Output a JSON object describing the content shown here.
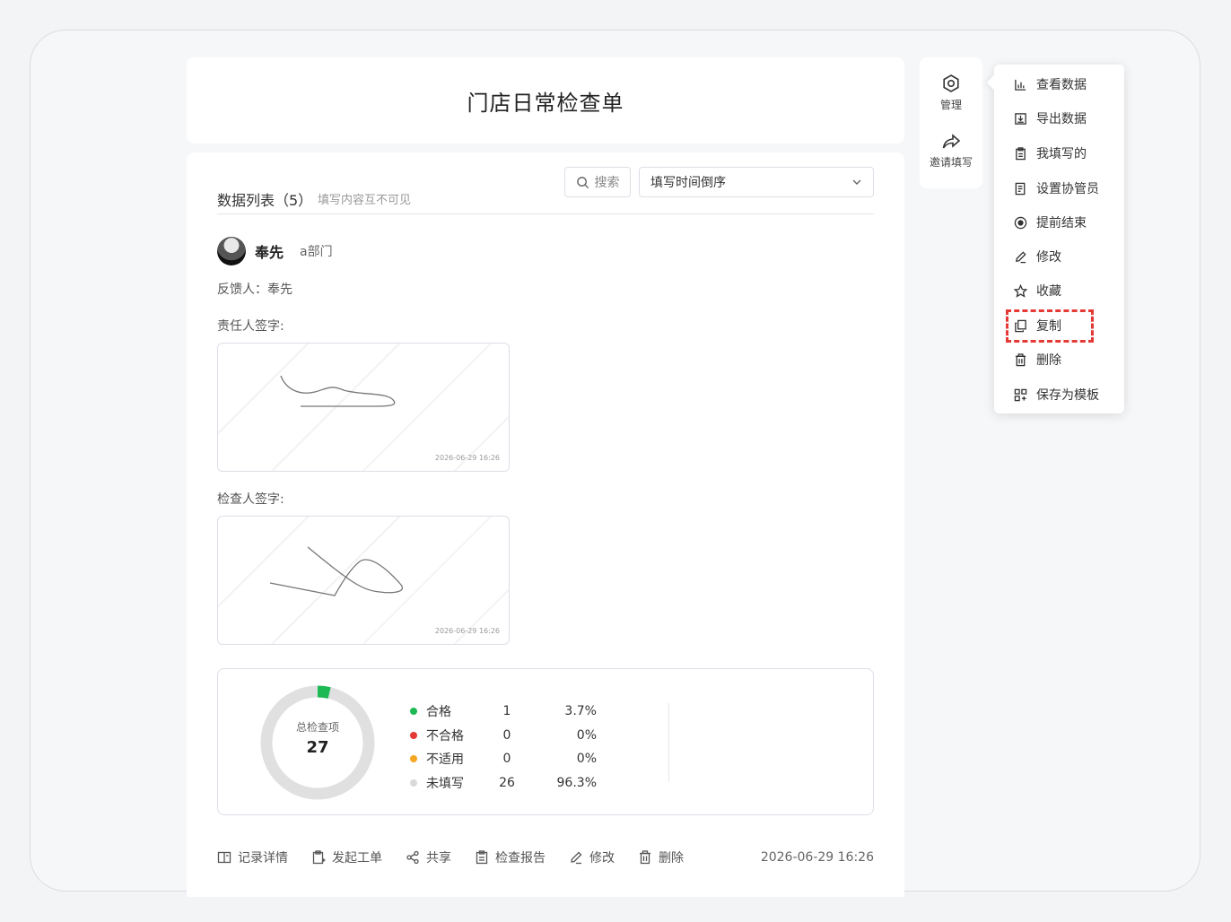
{
  "form": {
    "title": "门店日常检查单"
  },
  "list": {
    "title": "数据列表（5）",
    "hint": "填写内容互不可见",
    "search_label": "搜索",
    "sort_value": "填写时间倒序"
  },
  "record": {
    "user_name": "奉先",
    "department": "a部门",
    "feedback_line": "反馈人：奉先",
    "responsible_sign_label": "责任人签字:",
    "inspector_sign_label": "检查人签字:",
    "sign_timestamp_1": "2026-06-29 16:26",
    "sign_timestamp_2": "2026-06-29 16:26",
    "summary": {
      "center_title": "总检查项",
      "total": "27",
      "completion_fraction": 0.037,
      "rows": [
        {
          "label": "合格",
          "count": "1",
          "pct": "3.7%",
          "color": "#1db954"
        },
        {
          "label": "不合格",
          "count": "0",
          "pct": "0%",
          "color": "#e53935"
        },
        {
          "label": "不适用",
          "count": "0",
          "pct": "0%",
          "color": "#f5a623"
        },
        {
          "label": "未填写",
          "count": "26",
          "pct": "96.3%",
          "color": "#d9d9d9"
        }
      ]
    },
    "actions": {
      "detail": "记录详情",
      "work_order": "发起工单",
      "share": "共享",
      "report": "检查报告",
      "edit": "修改",
      "delete": "删除"
    },
    "time": "2026-06-29 16:26"
  },
  "side": {
    "manage": "管理",
    "invite": "邀请填写"
  },
  "menu": {
    "view_data": "查看数据",
    "export_data": "导出数据",
    "my_filled": "我填写的",
    "set_co_admin": "设置协管员",
    "end_early": "提前结束",
    "edit": "修改",
    "favorite": "收藏",
    "copy": "复制",
    "delete": "删除",
    "save_template": "保存为模板"
  }
}
